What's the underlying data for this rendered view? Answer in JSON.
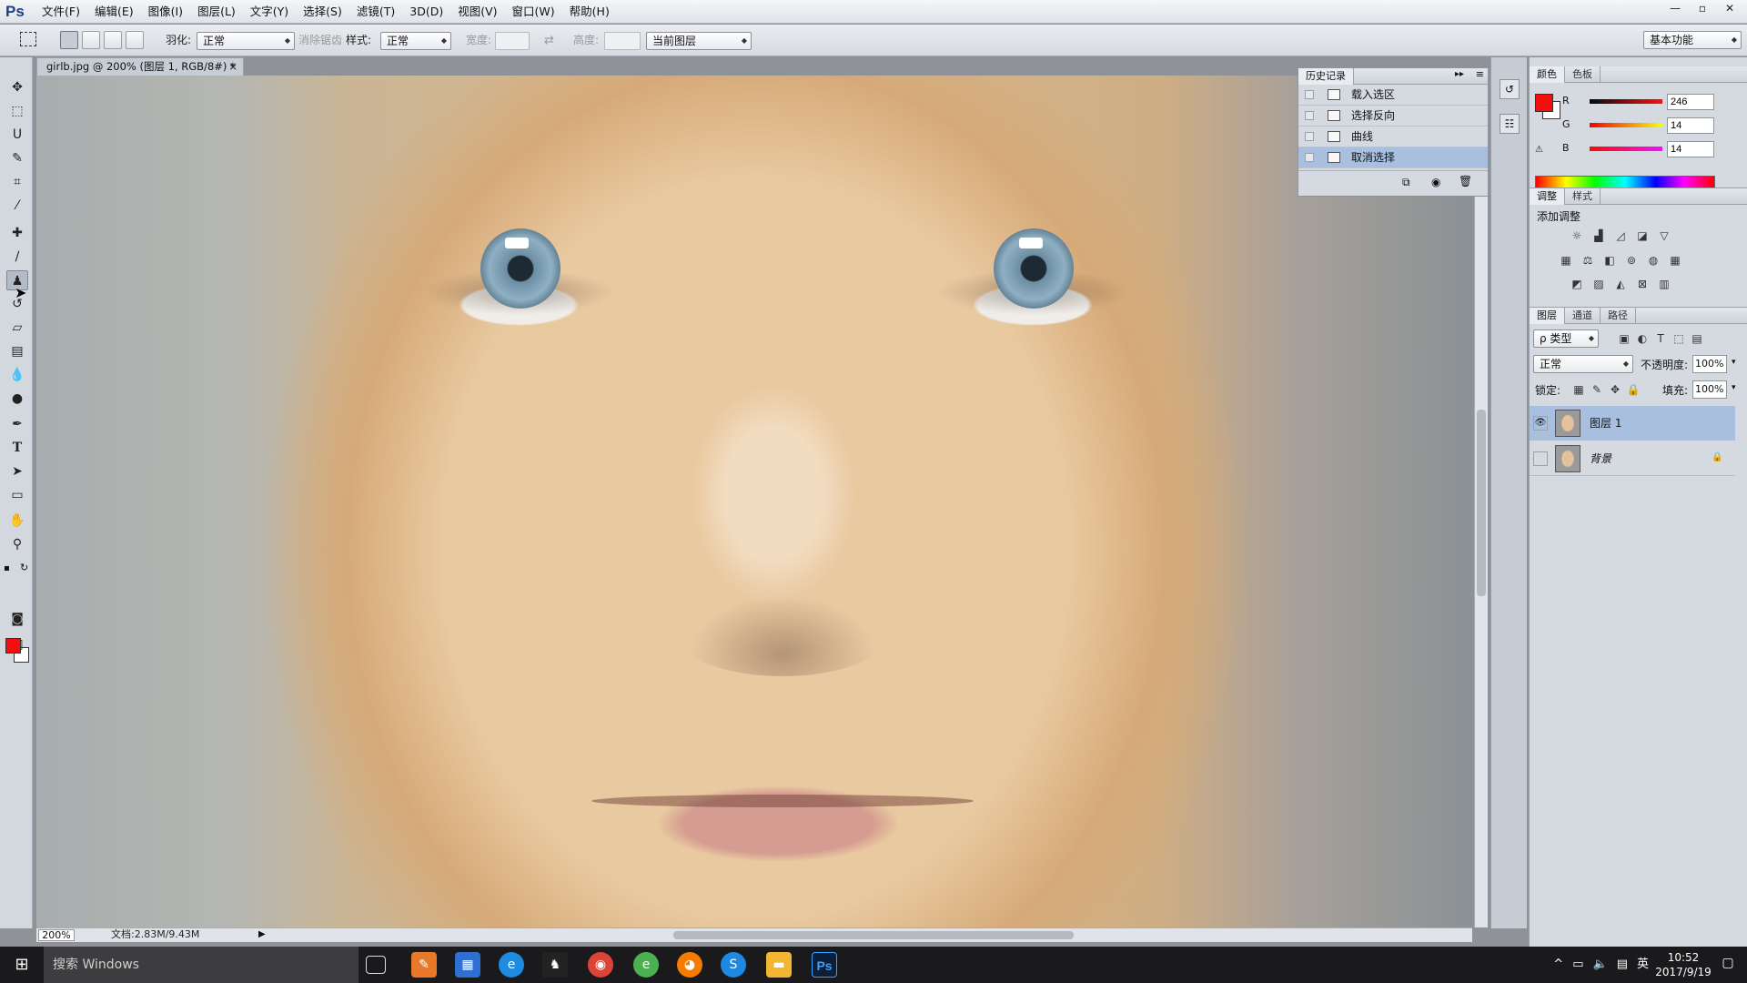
{
  "app": {
    "logo": "Ps"
  },
  "menu": [
    "文件(F)",
    "编辑(E)",
    "图像(I)",
    "图层(L)",
    "文字(Y)",
    "选择(S)",
    "滤镜(T)",
    "3D(D)",
    "视图(V)",
    "窗口(W)",
    "帮助(H)"
  ],
  "window_controls": {
    "minimize": "—",
    "restore": "▫",
    "close": "✕"
  },
  "options_bar": {
    "feather_label": "羽化:",
    "feather_value": "正常",
    "antialias_label": "消除锯齿",
    "style_label": "样式:",
    "style_value": "正常",
    "width_label": "宽度:",
    "height_label": "高度:",
    "sample_value": "当前图层",
    "workspace": "基本功能"
  },
  "document": {
    "tab_title": "girlb.jpg @ 200% (图层 1, RGB/8#) *",
    "zoom": "200%",
    "doc_info": "文档:2.83M/9.43M"
  },
  "history_panel": {
    "tab": "历史记录",
    "items": [
      {
        "label": "载入选区",
        "active": false
      },
      {
        "label": "选择反向",
        "active": false
      },
      {
        "label": "曲线",
        "active": false
      },
      {
        "label": "取消选择",
        "active": true
      }
    ]
  },
  "color_panel": {
    "tabs": [
      "颜色",
      "色板"
    ],
    "r_label": "R",
    "g_label": "G",
    "b_label": "B",
    "r": "246",
    "g": "14",
    "b": "14",
    "fg_color": "#f60e0e"
  },
  "adjustments_panel": {
    "tabs": [
      "调整",
      "样式"
    ],
    "title": "添加调整"
  },
  "layers_panel": {
    "tabs": [
      "图层",
      "通道",
      "路径"
    ],
    "filter": "ρ 类型",
    "blend_mode": "正常",
    "opacity_label": "不透明度:",
    "opacity": "100%",
    "lock_label": "锁定:",
    "fill_label": "填充:",
    "fill": "100%",
    "layers": [
      {
        "name": "图层 1",
        "visible": true,
        "active": true
      },
      {
        "name": "背景",
        "visible": false,
        "active": false,
        "locked": true
      }
    ]
  },
  "taskbar": {
    "search_placeholder": "搜索 Windows",
    "time": "10:52",
    "date": "2017/9/19",
    "ime": "英"
  }
}
